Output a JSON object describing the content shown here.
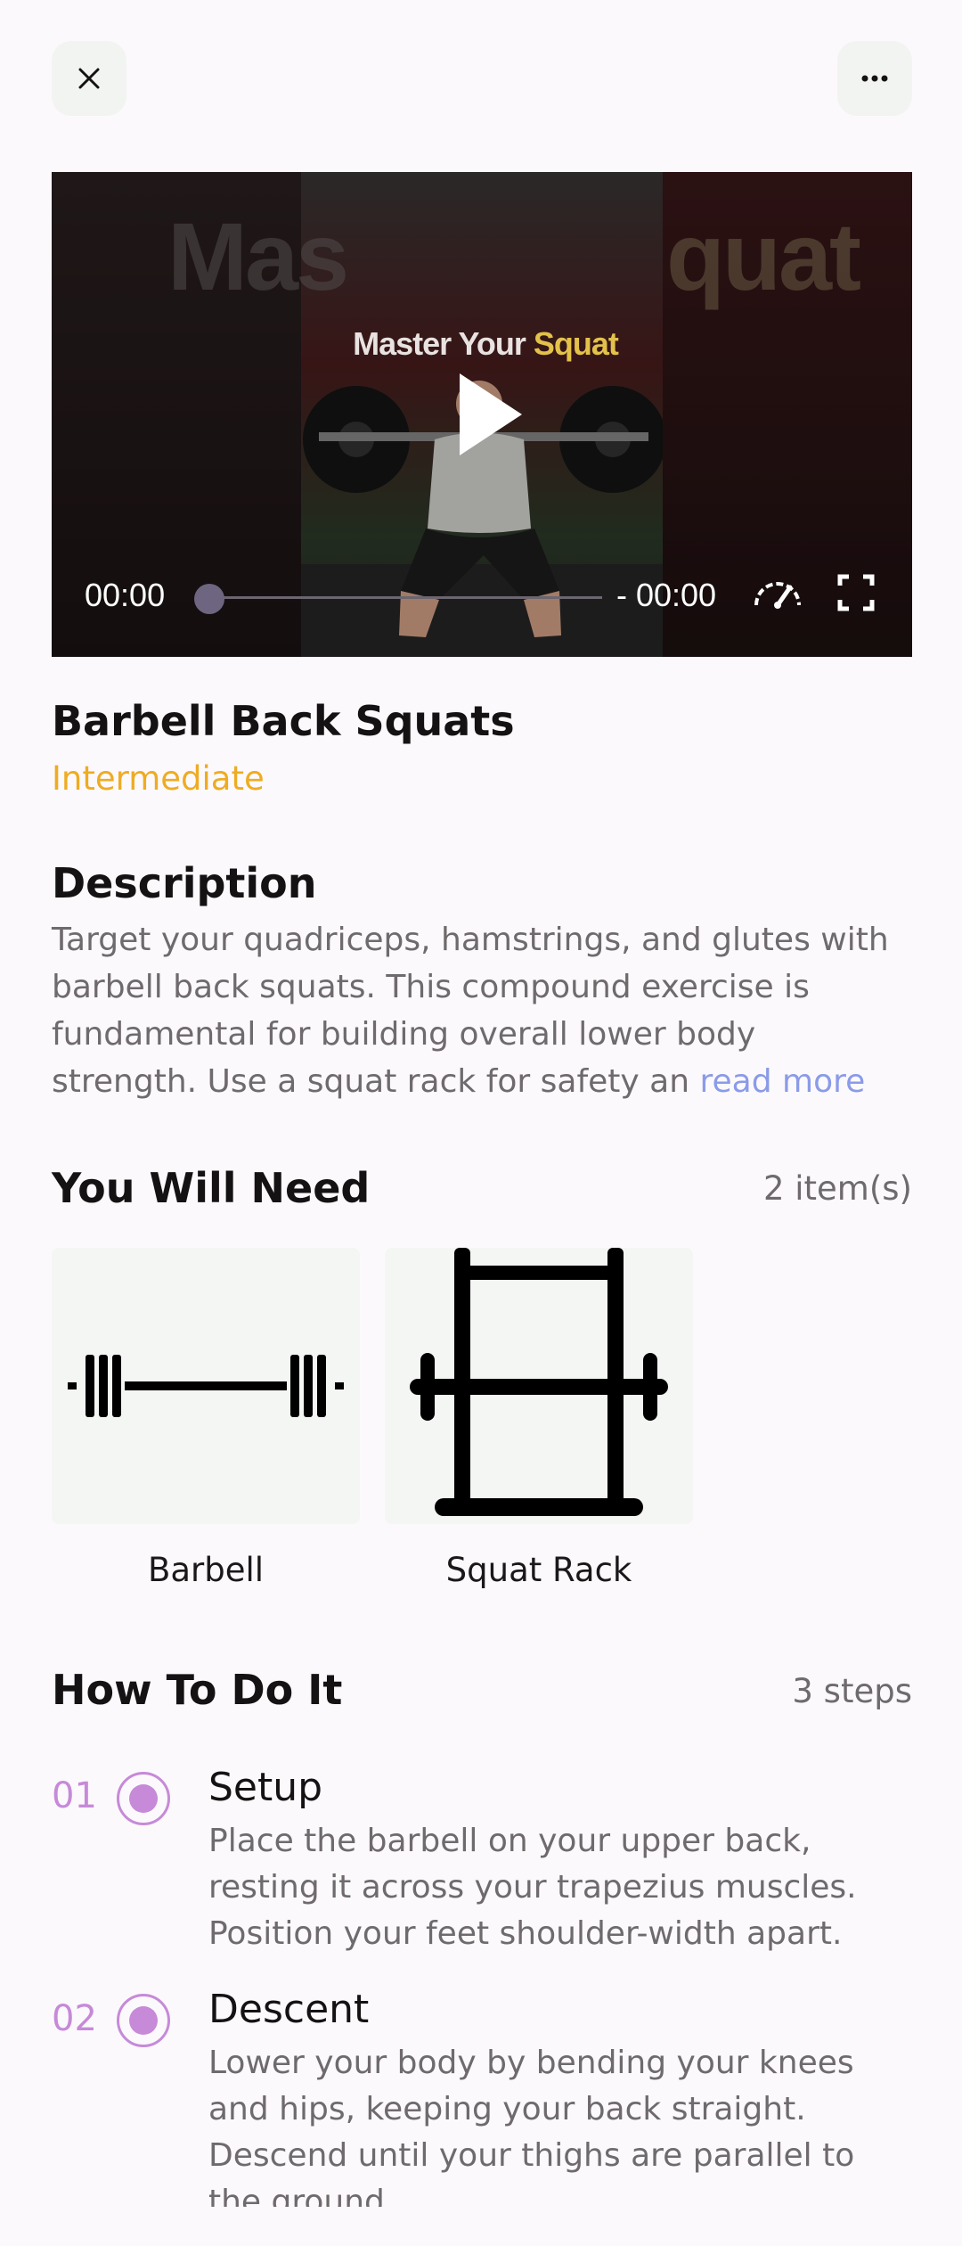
{
  "video": {
    "title_main": "Master Your",
    "title_highlight": "Squat",
    "bg_left": "Mas",
    "bg_right": "quat",
    "current_time": "00:00",
    "remaining_time": "- 00:00"
  },
  "exercise": {
    "title": "Barbell Back Squats",
    "level": "Intermediate"
  },
  "description": {
    "heading": "Description",
    "text": "Target your quadriceps, hamstrings, and glutes with barbell back squats. This compound exercise is fundamental for building overall lower body strength. Use a squat rack for safety an ",
    "read_more": "read more"
  },
  "equipment": {
    "heading": "You Will Need",
    "count": "2 item(s)",
    "items": [
      {
        "label": "Barbell",
        "icon": "barbell-icon"
      },
      {
        "label": "Squat Rack",
        "icon": "squat-rack-icon"
      }
    ]
  },
  "steps": {
    "heading": "How To Do It",
    "count": "3 steps",
    "items": [
      {
        "num": "01",
        "title": "Setup",
        "text": "Place the barbell on your upper back, resting it across your trapezius muscles. Position your feet shoulder-width apart."
      },
      {
        "num": "02",
        "title": "Descent",
        "text": "Lower your body by bending your knees and hips, keeping your back straight. Descend until your thighs are parallel to the ground."
      }
    ]
  },
  "colors": {
    "accent_level": "#eeac22",
    "accent_step": "#c68ad8",
    "link": "#8a9be8"
  }
}
